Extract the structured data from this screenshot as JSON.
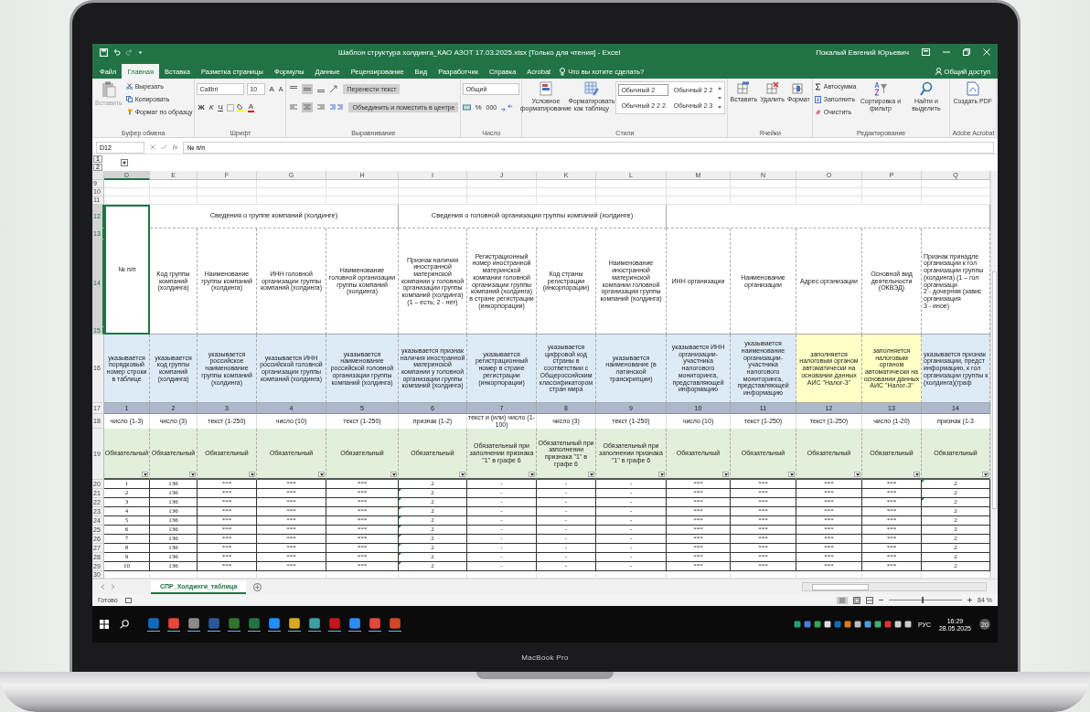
{
  "window": {
    "title": "Шаблон структура холдинга_КАО АЗОТ 17.03.2025.xlsx  [Только для чтения]  -  Excel",
    "user": "Покалый Евгений Юрьевич"
  },
  "tabs": [
    {
      "label": "Файл",
      "selected": false
    },
    {
      "label": "Главная",
      "selected": true
    },
    {
      "label": "Вставка",
      "selected": false
    },
    {
      "label": "Разметка страницы",
      "selected": false
    },
    {
      "label": "Формулы",
      "selected": false
    },
    {
      "label": "Данные",
      "selected": false
    },
    {
      "label": "Рецензирование",
      "selected": false
    },
    {
      "label": "Вид",
      "selected": false
    },
    {
      "label": "Разработчик",
      "selected": false
    },
    {
      "label": "Справка",
      "selected": false
    },
    {
      "label": "Acrobat",
      "selected": false
    }
  ],
  "tell_me": "Что вы хотите сделать?",
  "share": "Общий доступ",
  "clipboard": {
    "title": "Буфер обмена",
    "paste": {
      "label": "Вставить",
      "disabled": true
    },
    "cut": "Вырезать",
    "copy": "Копировать",
    "painter": "Формат по образцу"
  },
  "font": {
    "title": "Шрифт",
    "name": "Calibri",
    "size": "10",
    "grow": "A",
    "shrink": "A",
    "bold": "Ж",
    "italic": "К",
    "underline": "Ч",
    "text_fill": "A"
  },
  "alignment": {
    "title": "Выравнивание",
    "wrap": {
      "label": "Перенести текст",
      "on": true
    },
    "merge": {
      "label": "Объединить и поместить в центре",
      "on": true
    },
    "vertical": [
      {
        "selected": false
      },
      {
        "selected": true
      },
      {
        "selected": false
      }
    ],
    "horizontal": [
      {
        "selected": false
      },
      {
        "selected": true
      },
      {
        "selected": false
      }
    ]
  },
  "number": {
    "title": "Число",
    "format": "Общий",
    "percent": "%",
    "thousands": "000"
  },
  "styles": {
    "title": "Стили",
    "conditional": "Условное форматирование",
    "as_table": "Форматировать как таблицу",
    "gallery": [
      {
        "label": "Обычный 2",
        "selected": true
      },
      {
        "label": "Обычный 2 2",
        "selected": false
      },
      {
        "label": "Обычный 2 2 2",
        "selected": false
      },
      {
        "label": "Обычный 2 3",
        "selected": false
      }
    ]
  },
  "cells": {
    "title": "Ячейки",
    "buttons": [
      "Вставить",
      "Удалить",
      "Формат"
    ]
  },
  "editing": {
    "title": "Редактирование",
    "autosum": "Автосумма",
    "fill": "Заполнить",
    "clear": "Очистить",
    "sort": "Сортировка и фильтр",
    "find": "Найти и выделить"
  },
  "acrobat": {
    "title": "Adobe Acrobat",
    "create": "Создать PDF"
  },
  "formula_bar": {
    "cell": "D12",
    "fx": "fx",
    "formula": "№ п/п"
  },
  "outline_levels": [
    "1",
    "2"
  ],
  "columns": [
    {
      "letter": "D",
      "selected": true
    },
    {
      "letter": "E",
      "selected": false
    },
    {
      "letter": "F",
      "selected": false
    },
    {
      "letter": "G",
      "selected": false
    },
    {
      "letter": "H",
      "selected": false
    },
    {
      "letter": "I",
      "selected": false
    },
    {
      "letter": "J",
      "selected": false
    },
    {
      "letter": "K",
      "selected": false
    },
    {
      "letter": "L",
      "selected": false
    },
    {
      "letter": "M",
      "selected": false
    },
    {
      "letter": "N",
      "selected": false
    },
    {
      "letter": "O",
      "selected": false
    },
    {
      "letter": "P",
      "selected": false
    },
    {
      "letter": "Q",
      "selected": false
    }
  ],
  "row_numbers": [
    {
      "label": "9",
      "selected": false
    },
    {
      "label": "10",
      "selected": false
    },
    {
      "label": "11",
      "selected": false
    },
    {
      "label": "12",
      "selected": true
    },
    {
      "label": "13",
      "selected": true
    },
    {
      "label": "14",
      "selected": true
    },
    {
      "label": "15",
      "selected": true
    },
    {
      "label": "16",
      "selected": false
    },
    {
      "label": "17",
      "selected": false
    },
    {
      "label": "18",
      "selected": false
    },
    {
      "label": "19",
      "selected": false
    },
    {
      "label": "20",
      "selected": false
    },
    {
      "label": "21",
      "selected": false
    },
    {
      "label": "22",
      "selected": false
    },
    {
      "label": "23",
      "selected": false
    },
    {
      "label": "24",
      "selected": false
    },
    {
      "label": "25",
      "selected": false
    },
    {
      "label": "26",
      "selected": false
    },
    {
      "label": "27",
      "selected": false
    },
    {
      "label": "28",
      "selected": false
    },
    {
      "label": "29",
      "selected": false
    },
    {
      "label": "30",
      "selected": false
    }
  ],
  "number_header": {
    "text": "№ п/п",
    "selected": true
  },
  "groups": [
    {
      "title": "Сведения о группе компаний (холдинге)"
    },
    {
      "title": "Сведения о головной организации группы компаний (холдинге)"
    }
  ],
  "headers": [
    {
      "text": "Код группы компаний (холдинга)"
    },
    {
      "text": "Наименование группы компаний (холдинга)"
    },
    {
      "text": "ИНН головной организации группы компаний (холдинга)"
    },
    {
      "text": "Наименование головной организации группы компаний (холдинга)"
    },
    {
      "text": "Признак наличия иностранной материнской компании у головной организации группы компаний (холдинга) (1 – есть; 2 - нет)"
    },
    {
      "text": "Регистрационный номер иностранной материнской компании головной организации группы компаний (холдинга) в стране регистрации (инкорпорации)"
    },
    {
      "text": "Код страны регистрации (инкорпорации)"
    },
    {
      "text": "Наименование иностранной материнской компании головной организации группы компаний (холдинга)"
    },
    {
      "text": "ИНН организации"
    },
    {
      "text": "Наименование организации"
    },
    {
      "text": "Адрес организации"
    },
    {
      "text": "Основной вид деятельности (ОКВЭД)"
    },
    {
      "text": "Признак принадле\nорганизации к гол\nорганизации группы\n(холдинга) (1 – гол\nорганизаци\n2 - дочерняя (завис\nорганизация\n3 - иное)"
    }
  ],
  "descriptions": [
    {
      "text": "указывается порядковый номер строки в таблице",
      "kind": "input"
    },
    {
      "text": "указывается код группы компаний (холдинга)",
      "kind": "input"
    },
    {
      "text": "указывается российское наименование группы компаний (холдинга)",
      "kind": "input"
    },
    {
      "text": "указывается ИНН российской головной организации группы компаний (холдинга)",
      "kind": "input"
    },
    {
      "text": "указывается наименование российской головной организации группы компаний (холдинга)",
      "kind": "input"
    },
    {
      "text": "указывается признак наличия иностранной материнской компании у головной организации группы компаний (холдинга)",
      "kind": "input"
    },
    {
      "text": "указывается регистрационный номер в стране регистрации (инкорпорации)",
      "kind": "input"
    },
    {
      "text": "указывается цифровой код страны в соответствии с Общероссийским классификатором стран мира",
      "kind": "input"
    },
    {
      "text": "указывается наименование (в латинской транскрипции)",
      "kind": "input"
    },
    {
      "text": "указывается ИНН организации-участника налогового мониторинга, представляющей информацию",
      "kind": "input"
    },
    {
      "text": "указывается наименование организации-участника налогового мониторинга, представляющей информацию",
      "kind": "input"
    },
    {
      "text": "заполняется налоговым органом автоматически на основании данных АИС \"Налог-3\"",
      "kind": "auto"
    },
    {
      "text": "заполняется налоговым органом автоматически на основании данных АИС \"Налог-3\"",
      "kind": "auto"
    },
    {
      "text": "указывается признак\nорганизации, предст\nинформацию, к гол\nорганизации группы к\n(холдинга)(граф",
      "kind": "input"
    }
  ],
  "numbers": [
    "1",
    "2",
    "3",
    "4",
    "5",
    "6",
    "7",
    "8",
    "9",
    "10",
    "11",
    "12",
    "13",
    "14"
  ],
  "types": [
    "число (1-3)",
    "число (3)",
    "текст (1-250)",
    "число (10)",
    "текст (1-250)",
    "признак (1-2)",
    "текст и (или) число (1-100)",
    "число (3)",
    "текст (1-250)",
    "число (10)",
    "текст (1-250)",
    "текст (1-250)",
    "число (1-20)",
    "признак (1-3"
  ],
  "requirements": [
    "Обязательный",
    "Обязательный",
    "Обязательный",
    "Обязательный",
    "Обязательный",
    "Обязательный",
    "Обязательный при заполнении признака \"1\" в графе 6",
    "Обязательный при заполнении признака \"1\" в графе 6",
    "Обязательный при заполнении признака \"1\" в графе 6",
    "Обязательный",
    "Обязательный",
    "Обязательный",
    "Обязательный",
    "Обязательный"
  ],
  "data_rows": [
    {
      "cells": [
        "1",
        "136",
        "***",
        "***",
        "***",
        "2",
        "-",
        "-",
        "-",
        "***",
        "***",
        "***",
        "***",
        "2"
      ],
      "i_flag": false,
      "q_flag": true
    },
    {
      "cells": [
        "2",
        "136",
        "***",
        "***",
        "***",
        "2",
        "-",
        "-",
        "-",
        "***",
        "***",
        "***",
        "***",
        "2"
      ],
      "i_flag": true,
      "q_flag": false
    },
    {
      "cells": [
        "3",
        "136",
        "***",
        "***",
        "***",
        "2",
        "-",
        "-",
        "-",
        "***",
        "***",
        "***",
        "***",
        "2"
      ],
      "i_flag": true,
      "q_flag": true
    },
    {
      "cells": [
        "4",
        "136",
        "***",
        "***",
        "***",
        "2",
        "-",
        "-",
        "-",
        "***",
        "***",
        "***",
        "***",
        "2"
      ],
      "i_flag": true,
      "q_flag": false
    },
    {
      "cells": [
        "5",
        "136",
        "***",
        "***",
        "***",
        "2",
        "-",
        "-",
        "-",
        "***",
        "***",
        "***",
        "***",
        "2"
      ],
      "i_flag": true,
      "q_flag": false
    },
    {
      "cells": [
        "6",
        "136",
        "***",
        "***",
        "***",
        "2",
        "-",
        "-",
        "-",
        "***",
        "***",
        "***",
        "***",
        "2"
      ],
      "i_flag": true,
      "q_flag": false
    },
    {
      "cells": [
        "7",
        "136",
        "***",
        "***",
        "***",
        "2",
        "-",
        "-",
        "-",
        "***",
        "***",
        "***",
        "***",
        "2"
      ],
      "i_flag": true,
      "q_flag": false
    },
    {
      "cells": [
        "8",
        "136",
        "***",
        "***",
        "***",
        "2",
        "-",
        "-",
        "-",
        "***",
        "***",
        "***",
        "***",
        "2"
      ],
      "i_flag": true,
      "q_flag": false
    },
    {
      "cells": [
        "9",
        "136",
        "***",
        "***",
        "***",
        "2",
        "-",
        "-",
        "-",
        "***",
        "***",
        "***",
        "***",
        "2"
      ],
      "i_flag": true,
      "q_flag": false
    },
    {
      "cells": [
        "10",
        "136",
        "***",
        "***",
        "***",
        "2",
        "-",
        "-",
        "-",
        "***",
        "***",
        "***",
        "***",
        "2"
      ],
      "i_flag": true,
      "q_flag": false
    }
  ],
  "sheet_tabs": [
    {
      "label": "СПР_Холдинги_таблица",
      "selected": true
    }
  ],
  "status": {
    "ready": "Готово",
    "zoom": "84 %",
    "level": 0.45
  },
  "taskbar": {
    "lang": "РУС",
    "time": "16:29",
    "date": "28.05.2025",
    "notifications": "20"
  },
  "bezel_label": "MacBook Pro"
}
